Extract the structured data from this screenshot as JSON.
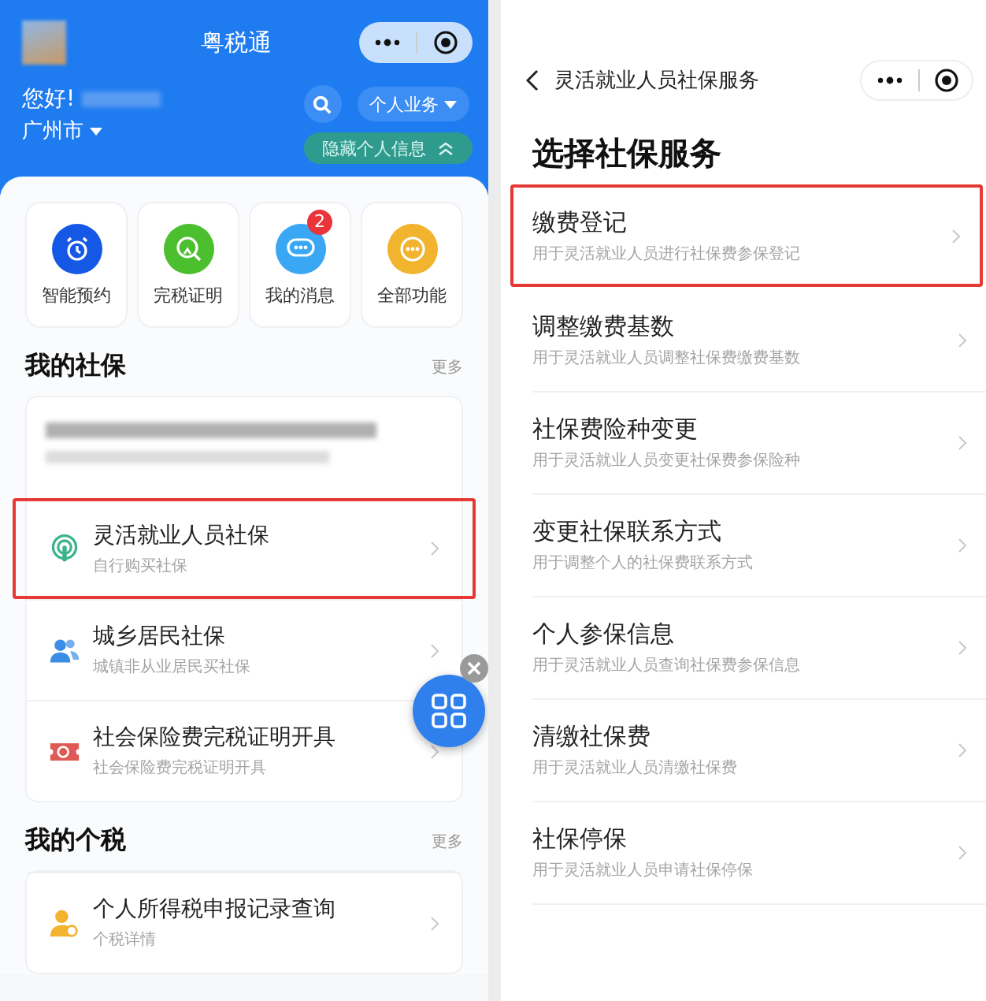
{
  "left": {
    "header": {
      "title": "粤税通",
      "greeting": "您好!",
      "city": "广州市",
      "business_button": "个人业务",
      "hide_info_button": "隐藏个人信息"
    },
    "shortcuts": [
      {
        "label": "智能预约",
        "kind": "alarm",
        "color": "#1558e6"
      },
      {
        "label": "完税证明",
        "kind": "search",
        "color": "#4cbf2e"
      },
      {
        "label": "我的消息",
        "kind": "chat",
        "color": "#3aa7f5",
        "badge": "2"
      },
      {
        "label": "全部功能",
        "kind": "more",
        "color": "#f2b32e"
      }
    ],
    "social_section": {
      "title": "我的社保",
      "more": "更多",
      "items": [
        {
          "title": "灵活就业人员社保",
          "subtitle": "自行购买社保",
          "kind": "signal",
          "highlighted": true
        },
        {
          "title": "城乡居民社保",
          "subtitle": "城镇非从业居民买社保",
          "kind": "people",
          "highlighted": false
        },
        {
          "title": "社会保险费完税证明开具",
          "subtitle": "社会保险费完税证明开具",
          "kind": "ticket",
          "highlighted": false
        }
      ]
    },
    "tax_section": {
      "title": "我的个税",
      "more": "更多",
      "items": [
        {
          "title": "个人所得税申报记录查询",
          "subtitle": "个税详情",
          "kind": "person",
          "highlighted": false
        }
      ]
    }
  },
  "right": {
    "nav_title": "灵活就业人员社保服务",
    "heading": "选择社保服务",
    "items": [
      {
        "title": "缴费登记",
        "subtitle": "用于灵活就业人员进行社保费参保登记",
        "highlighted": true
      },
      {
        "title": "调整缴费基数",
        "subtitle": "用于灵活就业人员调整社保费缴费基数",
        "highlighted": false
      },
      {
        "title": "社保费险种变更",
        "subtitle": "用于灵活就业人员变更社保费参保险种",
        "highlighted": false
      },
      {
        "title": "变更社保联系方式",
        "subtitle": "用于调整个人的社保费联系方式",
        "highlighted": false
      },
      {
        "title": "个人参保信息",
        "subtitle": "用于灵活就业人员查询社保费参保信息",
        "highlighted": false
      },
      {
        "title": "清缴社保费",
        "subtitle": "用于灵活就业人员清缴社保费",
        "highlighted": false
      },
      {
        "title": "社保停保",
        "subtitle": "用于灵活就业人员申请社保停保",
        "highlighted": false
      }
    ]
  }
}
